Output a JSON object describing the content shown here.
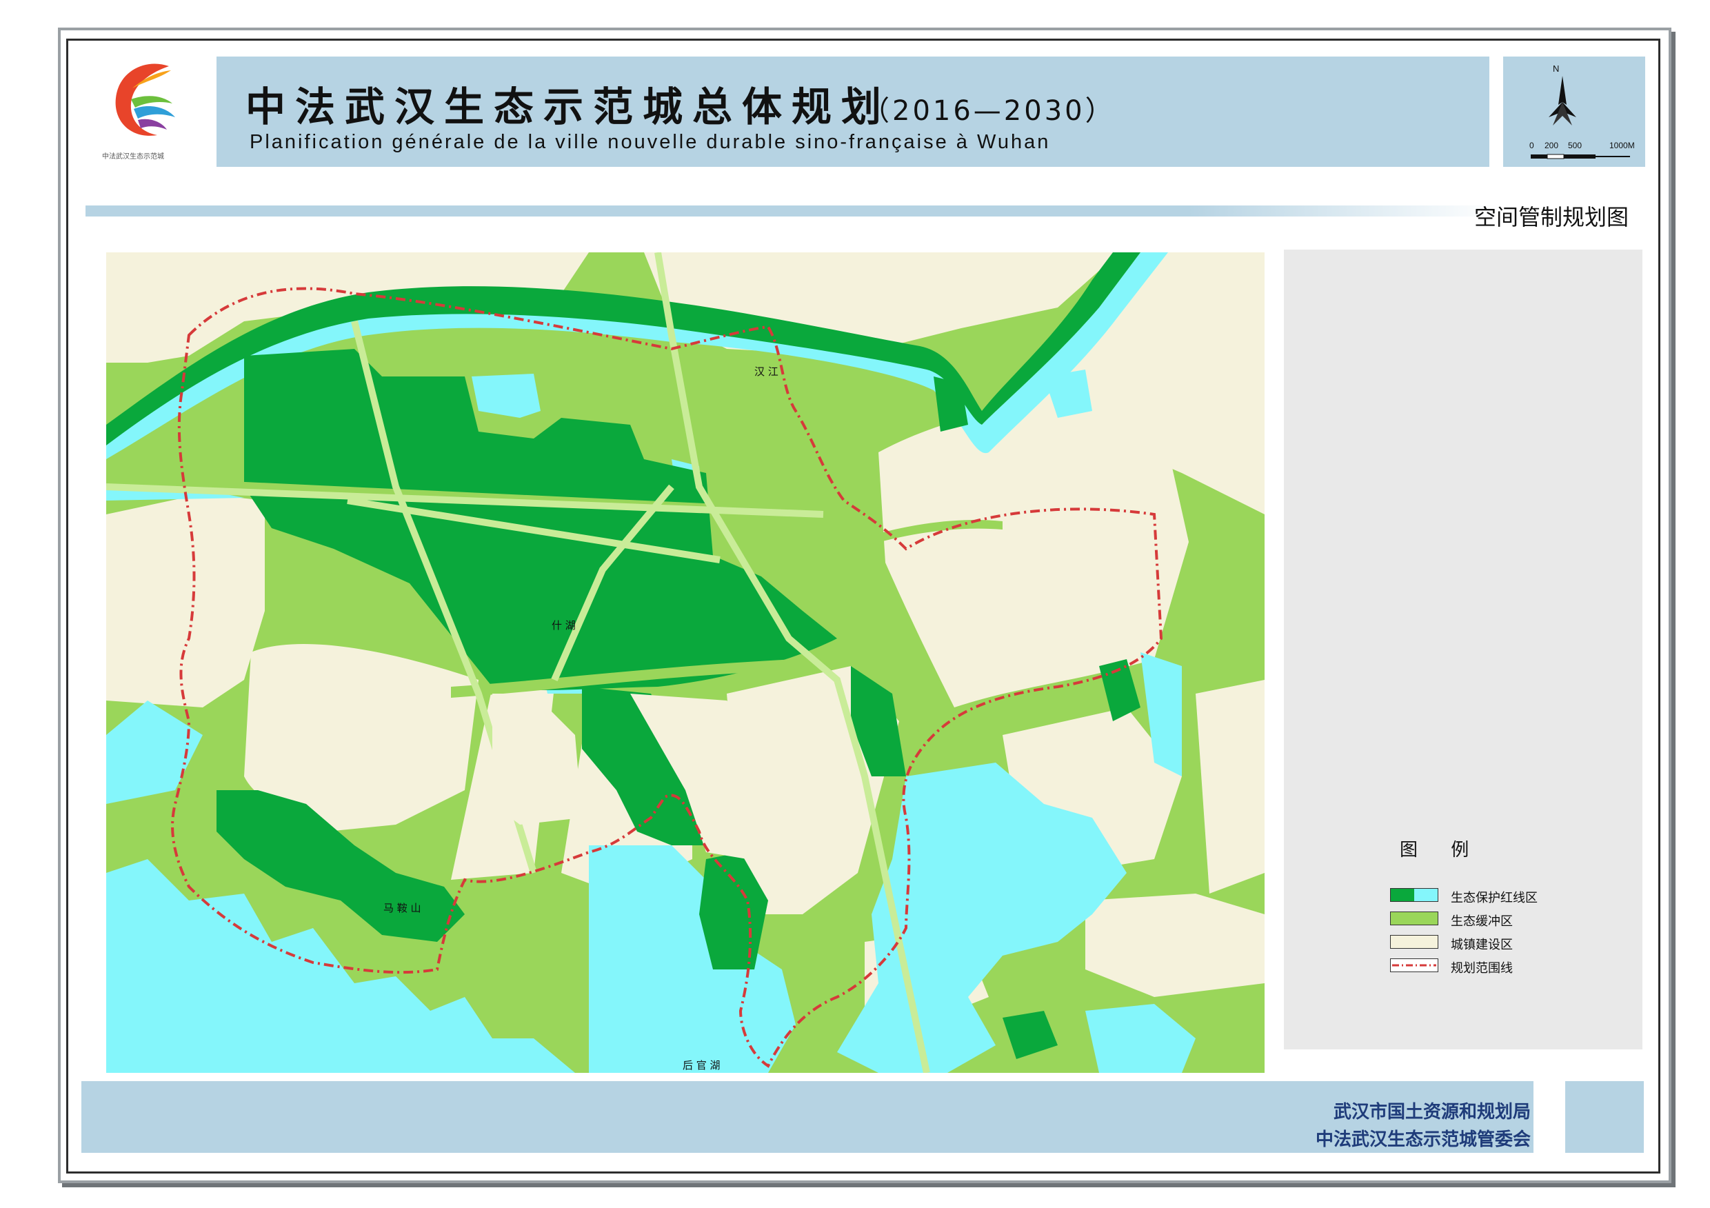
{
  "header": {
    "title_cn": "中法武汉生态示范城总体规划",
    "title_years": "（2016—2030）",
    "title_fr": "Planification générale de la ville nouvelle durable sino-française à Wuhan",
    "logo_caption": "中法武汉生态示范城"
  },
  "north_arrow": {
    "label": "N",
    "scale_labels": [
      "0",
      "200",
      "500",
      "1000M"
    ]
  },
  "map_title": "空间管制规划图",
  "map_labels": {
    "river": "汉 江",
    "lake_center": "什 湖",
    "mountain": "马 鞍 山",
    "lake_south": "后 官 湖"
  },
  "legend": {
    "title": "图 例",
    "items": [
      {
        "label": "生态保护红线区",
        "colors": [
          "#0aa83c",
          "#84f6fb"
        ]
      },
      {
        "label": "生态缓冲区",
        "colors": [
          "#9ad65a"
        ]
      },
      {
        "label": "城镇建设区",
        "colors": [
          "#f5f2dc"
        ]
      },
      {
        "label": "规划范围线",
        "colors": [
          "#d63a3a"
        ]
      }
    ]
  },
  "colors": {
    "eco_red_line": "#0aa83c",
    "water": "#84f6fb",
    "buffer": "#9ad65a",
    "urban": "#f5f2dc",
    "boundary": "#d63a3a",
    "band": "#b6d3e3"
  },
  "footer": {
    "line1": "武汉市国土资源和规划局",
    "line2": "中法武汉生态示范城管委会"
  }
}
